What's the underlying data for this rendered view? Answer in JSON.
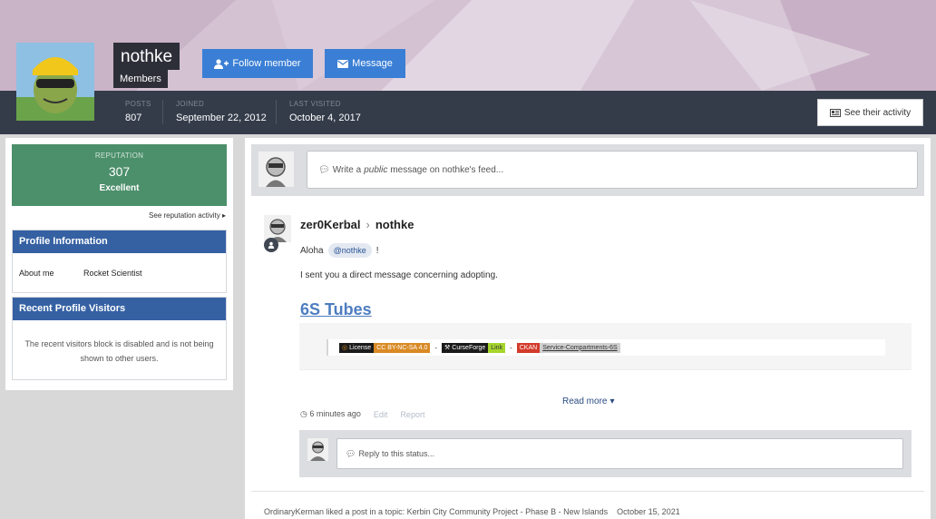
{
  "profile": {
    "username": "nothke",
    "group": "Members",
    "follow_label": "Follow member",
    "message_label": "Message",
    "activity_label": "See their activity"
  },
  "stats": [
    {
      "label": "POSTS",
      "value": "807"
    },
    {
      "label": "JOINED",
      "value": "September 22, 2012"
    },
    {
      "label": "LAST VISITED",
      "value": "October 4, 2017"
    }
  ],
  "sidebar": {
    "reputation_label": "REPUTATION",
    "reputation_value": "307",
    "reputation_rank": "Excellent",
    "reputation_link": "See reputation activity",
    "profile_info_title": "Profile Information",
    "about_label": "About me",
    "about_value": "Rocket Scientist",
    "visitors_title": "Recent Profile Visitors",
    "visitors_text": "The recent visitors block is disabled and is not being shown to other users."
  },
  "composer": {
    "prefix": "Write a",
    "emphasis": "public",
    "suffix": "message on nothke's feed..."
  },
  "status": {
    "author": "zer0Kerbal",
    "target": "nothke",
    "greeting": "Aloha",
    "mention": "@nothke",
    "exclaim": "!",
    "body": "I sent you a direct message concerning adopting.",
    "embed_title": "6S Tubes",
    "badges": {
      "license_left": "License",
      "license_right": "CC BY-NC-SA 4.0",
      "curse_left": "CurseForge",
      "curse_right": "Link",
      "ckan_left": "CKAN",
      "ckan_right": "Service-Compartments-6S"
    },
    "read_more": "Read more",
    "time": "6 minutes ago",
    "edit": "Edit",
    "report": "Report",
    "reply_placeholder": "Reply to this status..."
  },
  "activity": {
    "text": "OrdinaryKerman liked a post in a topic: Kerbin City Community Project - Phase B - New Islands",
    "date": "October 15, 2021"
  },
  "colors": {
    "accent_blue": "#3a7fd5",
    "reputation_green": "#4c8f6b",
    "widget_header": "#3561a3",
    "stats_bar": "#343c4a"
  }
}
